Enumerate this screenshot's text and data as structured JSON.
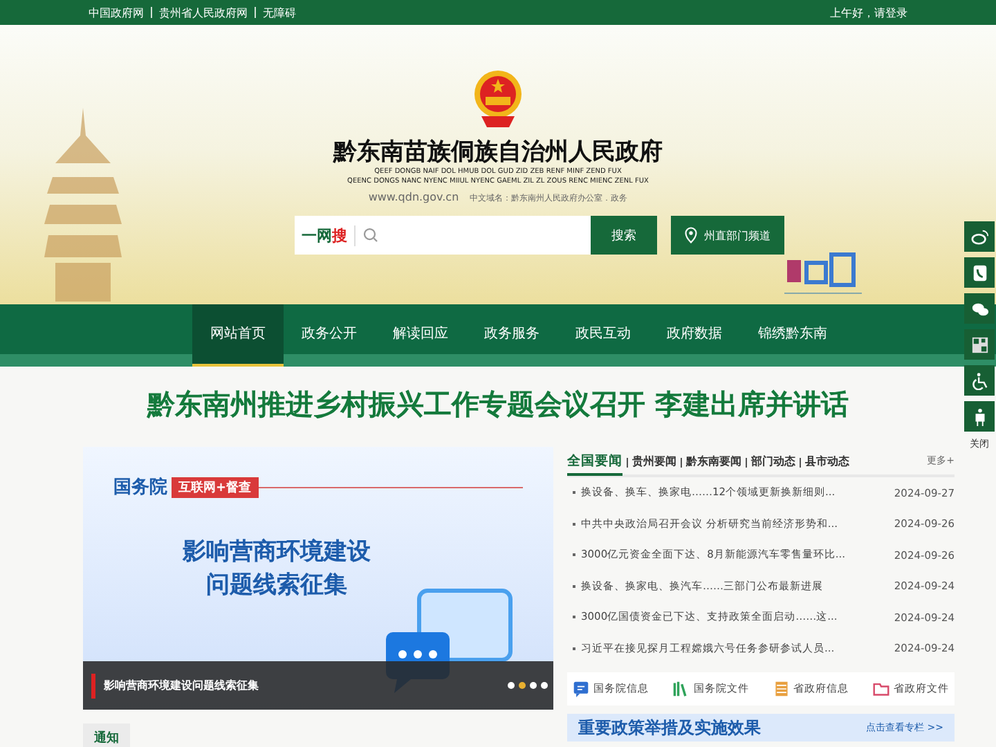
{
  "top_bar": {
    "links": [
      "中国政府网",
      "贵州省人民政府网",
      "无障碍"
    ],
    "greeting": "上午好，请登录"
  },
  "header": {
    "title": "黔东南苗族侗族自治州人民政府",
    "subtitle_lines": [
      "QEEF DONGB NAIF DOL HMUB DOL GUD ZID ZEB RENF MINF ZEND FUX",
      "QEENC DONGS NANC NYENC MIIUL NYENC GAEML ZIL ZL ZOUS RENC MIENC ZENL FUX"
    ],
    "domain": "www.qdn.gov.cn",
    "cn_domain": "中文域名：黔东南州人民政府办公室．政务",
    "search": {
      "brand": "一网",
      "brand_accent": "搜",
      "button": "搜索"
    },
    "channel_button": "州直部门频道"
  },
  "nav": [
    {
      "label": "网站首页",
      "selected": true
    },
    {
      "label": "政务公开",
      "selected": false
    },
    {
      "label": "解读回应",
      "selected": false
    },
    {
      "label": "政务服务",
      "selected": false
    },
    {
      "label": "政民互动",
      "selected": false
    },
    {
      "label": "政府数据",
      "selected": false
    },
    {
      "label": "锦绣黔东南",
      "selected": false
    }
  ],
  "headline": "黔东南州推进乡村振兴工作专题会议召开 李建出席并讲话",
  "carousel": {
    "org": "国务院",
    "tag": "互联网+督查",
    "title_lines": [
      "影响营商环境建设",
      "问题线索征集"
    ],
    "caption": "影响营商环境建设问题线索征集",
    "dots": [
      {
        "selected": false
      },
      {
        "selected": true
      },
      {
        "selected": false
      },
      {
        "selected": false
      }
    ]
  },
  "notice": {
    "label": "通知"
  },
  "news": {
    "tabs": [
      {
        "label": "全国要闻",
        "selected": true
      },
      {
        "label": "贵州要闻",
        "selected": false
      },
      {
        "label": "黔东南要闻",
        "selected": false
      },
      {
        "label": "部门动态",
        "selected": false
      },
      {
        "label": "县市动态",
        "selected": false
      }
    ],
    "more": "更多+",
    "items": [
      {
        "title": "换设备、换车、换家电……12个领域更新换新细则...",
        "date": "2024-09-27"
      },
      {
        "title": "中共中央政治局召开会议 分析研究当前经济形势和...",
        "date": "2024-09-26"
      },
      {
        "title": "3000亿元资金全面下达、8月新能源汽车零售量环比...",
        "date": "2024-09-26"
      },
      {
        "title": "换设备、换家电、换汽车……三部门公布最新进展",
        "date": "2024-09-24"
      },
      {
        "title": "3000亿国债资金已下达、支持政策全面启动……这...",
        "date": "2024-09-24"
      },
      {
        "title": "习近平在接见探月工程嫦娥六号任务参研参试人员...",
        "date": "2024-09-24"
      }
    ]
  },
  "quick_links": [
    {
      "label": "国务院信息",
      "kind": "chat"
    },
    {
      "label": "国务院文件",
      "kind": "books"
    },
    {
      "label": "省政府信息",
      "kind": "list"
    },
    {
      "label": "省政府文件",
      "kind": "folder"
    }
  ],
  "policy_banner": {
    "title": "重要政策举措及实施效果",
    "link": "点击查看专栏 >>"
  },
  "side_tools": {
    "items": [
      {
        "kind": "weibo"
      },
      {
        "kind": "phone"
      },
      {
        "kind": "wechat"
      },
      {
        "kind": "qrcode"
      },
      {
        "kind": "accessibility"
      },
      {
        "kind": "elder"
      }
    ],
    "close": "关闭"
  }
}
